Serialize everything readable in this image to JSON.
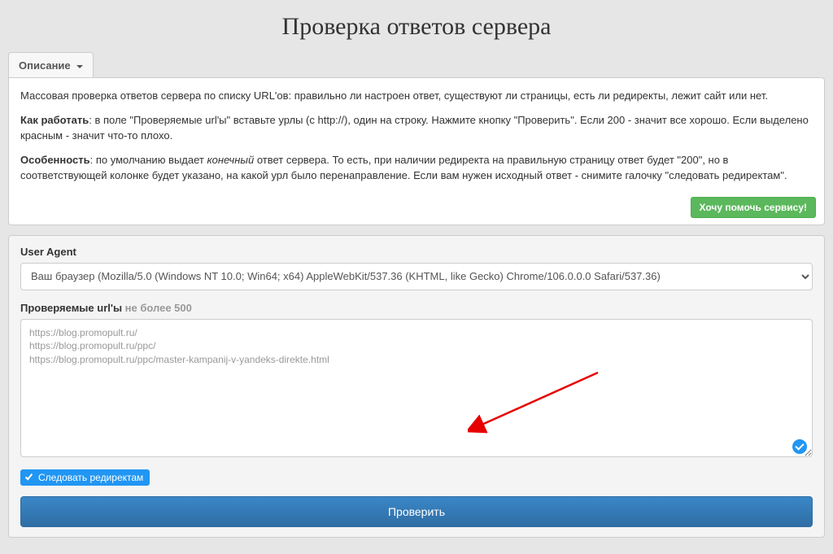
{
  "page_title": "Проверка ответов сервера",
  "tab_label": "Описание",
  "description": {
    "p1_prefix": "Массовая проверка ответов сервера по списку URL'ов: правильно ли настроен ответ, существуют ли страницы, есть ли редиректы, лежит сайт или нет.",
    "p2_bold": "Как работать",
    "p2_rest": ": в поле \"Проверяемые url'ы\" вставьте урлы (с http://), один на строку. Нажмите кнопку \"Проверить\". Если 200 - значит все хорошо. Если выделено красным - значит что-то плохо.",
    "p3_bold": "Особенность",
    "p3_part1": ": по умолчанию выдает ",
    "p3_em": "конечный",
    "p3_part2": " ответ сервера. То есть, при наличии редиректа на правильную страницу ответ будет \"200\", но в соответствующей колонке будет указано, на какой урл было перенаправление. Если вам нужен исходный ответ - снимите галочку \"следовать редиректам\"."
  },
  "help_button": "Хочу помочь сервису!",
  "form": {
    "ua_label": "User Agent",
    "ua_value": "Ваш браузер (Mozilla/5.0 (Windows NT 10.0; Win64; x64) AppleWebKit/537.36 (KHTML, like Gecko) Chrome/106.0.0.0 Safari/537.36)",
    "urls_label": "Проверяемые url'ы",
    "urls_limit": " не более 500",
    "urls_value": "https://blog.promopult.ru/\nhttps://blog.promopult.ru/ppc/\nhttps://blog.promopult.ru/ppc/master-kampanij-v-yandeks-direkte.html",
    "follow_redirects_label": "Следовать редиректам",
    "follow_redirects_checked": true,
    "submit_label": "Проверить"
  }
}
